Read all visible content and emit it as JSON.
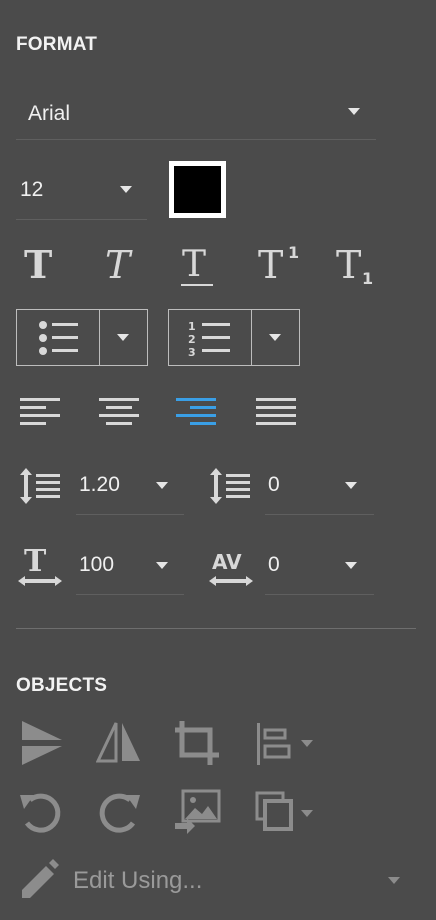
{
  "format": {
    "title": "FORMAT",
    "font_family": "Arial",
    "font_size": "12",
    "color": "#000000",
    "text_styles": [
      "bold",
      "italic",
      "underline",
      "superscript",
      "subscript"
    ],
    "alignment": [
      "left",
      "center",
      "right",
      "justify"
    ],
    "selected_alignment": "right",
    "line_spacing": "1.20",
    "paragraph_spacing": "0",
    "scale": "100",
    "tracking": "0"
  },
  "objects": {
    "title": "OBJECTS",
    "edit_label": "Edit Using..."
  },
  "colors": {
    "panel_bg": "#4b4b4b",
    "icon": "#d8d8d8",
    "icon_disabled": "#8c8c8c",
    "accent": "#3a9fe6"
  }
}
